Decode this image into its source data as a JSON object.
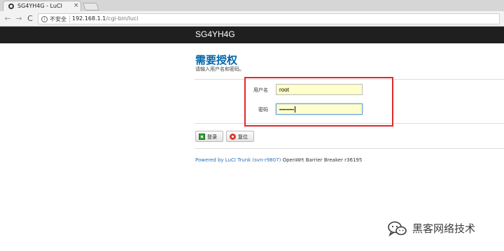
{
  "browser": {
    "tab_title": "SG4YH4G - LuCI",
    "tab_close": "×",
    "nav_back": "←",
    "nav_forward": "→",
    "nav_reload": "C",
    "security_label": "不安全",
    "url_host": "192.168.1.1",
    "url_path": "/cgi-bin/luci"
  },
  "header": {
    "brand": "SG4YH4G"
  },
  "login": {
    "title": "需要授权",
    "hint": "请输入用户名和密码。",
    "username_label": "用户名",
    "username_value": "root",
    "password_label": "密码",
    "password_mask": "••••••••••",
    "login_button": "登录",
    "reset_button": "复位"
  },
  "footer": {
    "powered_by": "Powered by LuCI Trunk (svn-r9807)",
    "firmware": " OpenWrt Barrier Breaker r36195"
  },
  "watermark": {
    "text": "黑客网络技术"
  },
  "colors": {
    "accent": "#0066aa",
    "header_bg": "#1f1f1f",
    "highlight": "#e0292b",
    "input_bg": "#ffffcc"
  },
  "icons": [
    "tab-favicon-icon",
    "info-icon",
    "login-icon",
    "reset-icon",
    "wechat-icon"
  ]
}
